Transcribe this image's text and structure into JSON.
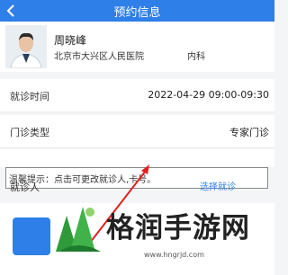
{
  "header": {
    "back_icon": "chevron-left-icon",
    "title": "预约信息"
  },
  "doctor": {
    "name": "周晓峰",
    "hospital": "北京市大兴区人民医院",
    "department": "内科"
  },
  "appointment": {
    "time_label": "就诊时间",
    "time_value": "2022-04-29 09:00-09:30",
    "type_label": "门诊类型",
    "type_value": "专家门诊"
  },
  "tip": {
    "text": "温馨提示：点击可更改就诊人,卡号。"
  },
  "patient": {
    "label": "就诊人",
    "select_label": "选择就诊"
  },
  "watermark": {
    "brand": "格润手游网",
    "url": "www.hngrjd.com"
  },
  "colors": {
    "primary": "#2f7fe8",
    "arrow": "#e02020",
    "logo_green": "#2e9a3a"
  }
}
